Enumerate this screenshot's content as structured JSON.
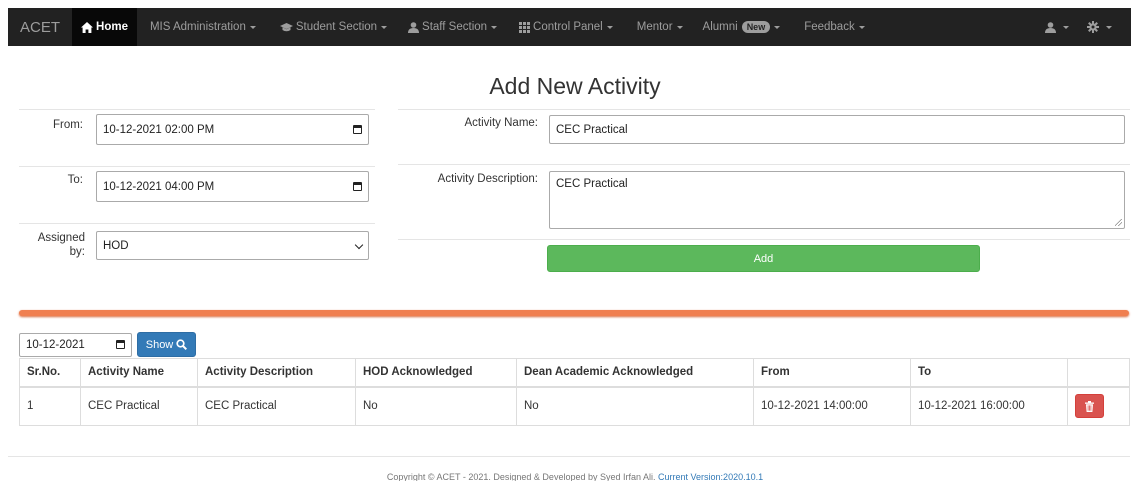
{
  "navbar": {
    "brand": "ACET",
    "items": [
      {
        "label": "Home",
        "icon": "home-icon"
      },
      {
        "label": "MIS Administration"
      },
      {
        "label": "Student Section",
        "icon": "graduation-cap-icon"
      },
      {
        "label": "Staff Section",
        "icon": "user-icon"
      },
      {
        "label": "Control Panel",
        "icon": "grid-icon"
      },
      {
        "label": "Mentor"
      },
      {
        "label": "Alumni",
        "badge": "New"
      },
      {
        "label": "Feedback"
      }
    ],
    "right_icons": [
      "user-icon",
      "gear-icon"
    ]
  },
  "page": {
    "title": "Add New Activity"
  },
  "form": {
    "from_label": "From:",
    "from_value": "10-12-2021 02:00 PM",
    "to_label": "To:",
    "to_value": "10-12-2021 04:00 PM",
    "assigned_by_label_1": "Assigned",
    "assigned_by_label_2": "by:",
    "assigned_by_value": "HOD",
    "activity_name_label": "Activity Name:",
    "activity_name_value": "CEC Practical",
    "activity_description_label": "Activity Description:",
    "activity_description_value": "CEC Practical",
    "add_button": "Add"
  },
  "filter": {
    "date_value": "10-12-2021",
    "show_button": "Show"
  },
  "table": {
    "headers": [
      "Sr.No.",
      "Activity Name",
      "Activity Description",
      "HOD Acknowledged",
      "Dean Academic Acknowledged",
      "From",
      "To"
    ],
    "rows": [
      [
        "1",
        "CEC Practical",
        "CEC Practical",
        "No",
        "No",
        "10-12-2021 14:00:00",
        "10-12-2021 16:00:00"
      ]
    ]
  },
  "footer": {
    "text": "Copyright © ACET - 2021. Designed & Developed by Syed Irfan Ali.",
    "version": "Current Version:2020.10.1"
  },
  "colors": {
    "navbar_bg": "#222222",
    "add_button": "#5cb85c",
    "show_button": "#337ab7",
    "delete_button": "#d9534f",
    "separator": "#f07f50"
  }
}
